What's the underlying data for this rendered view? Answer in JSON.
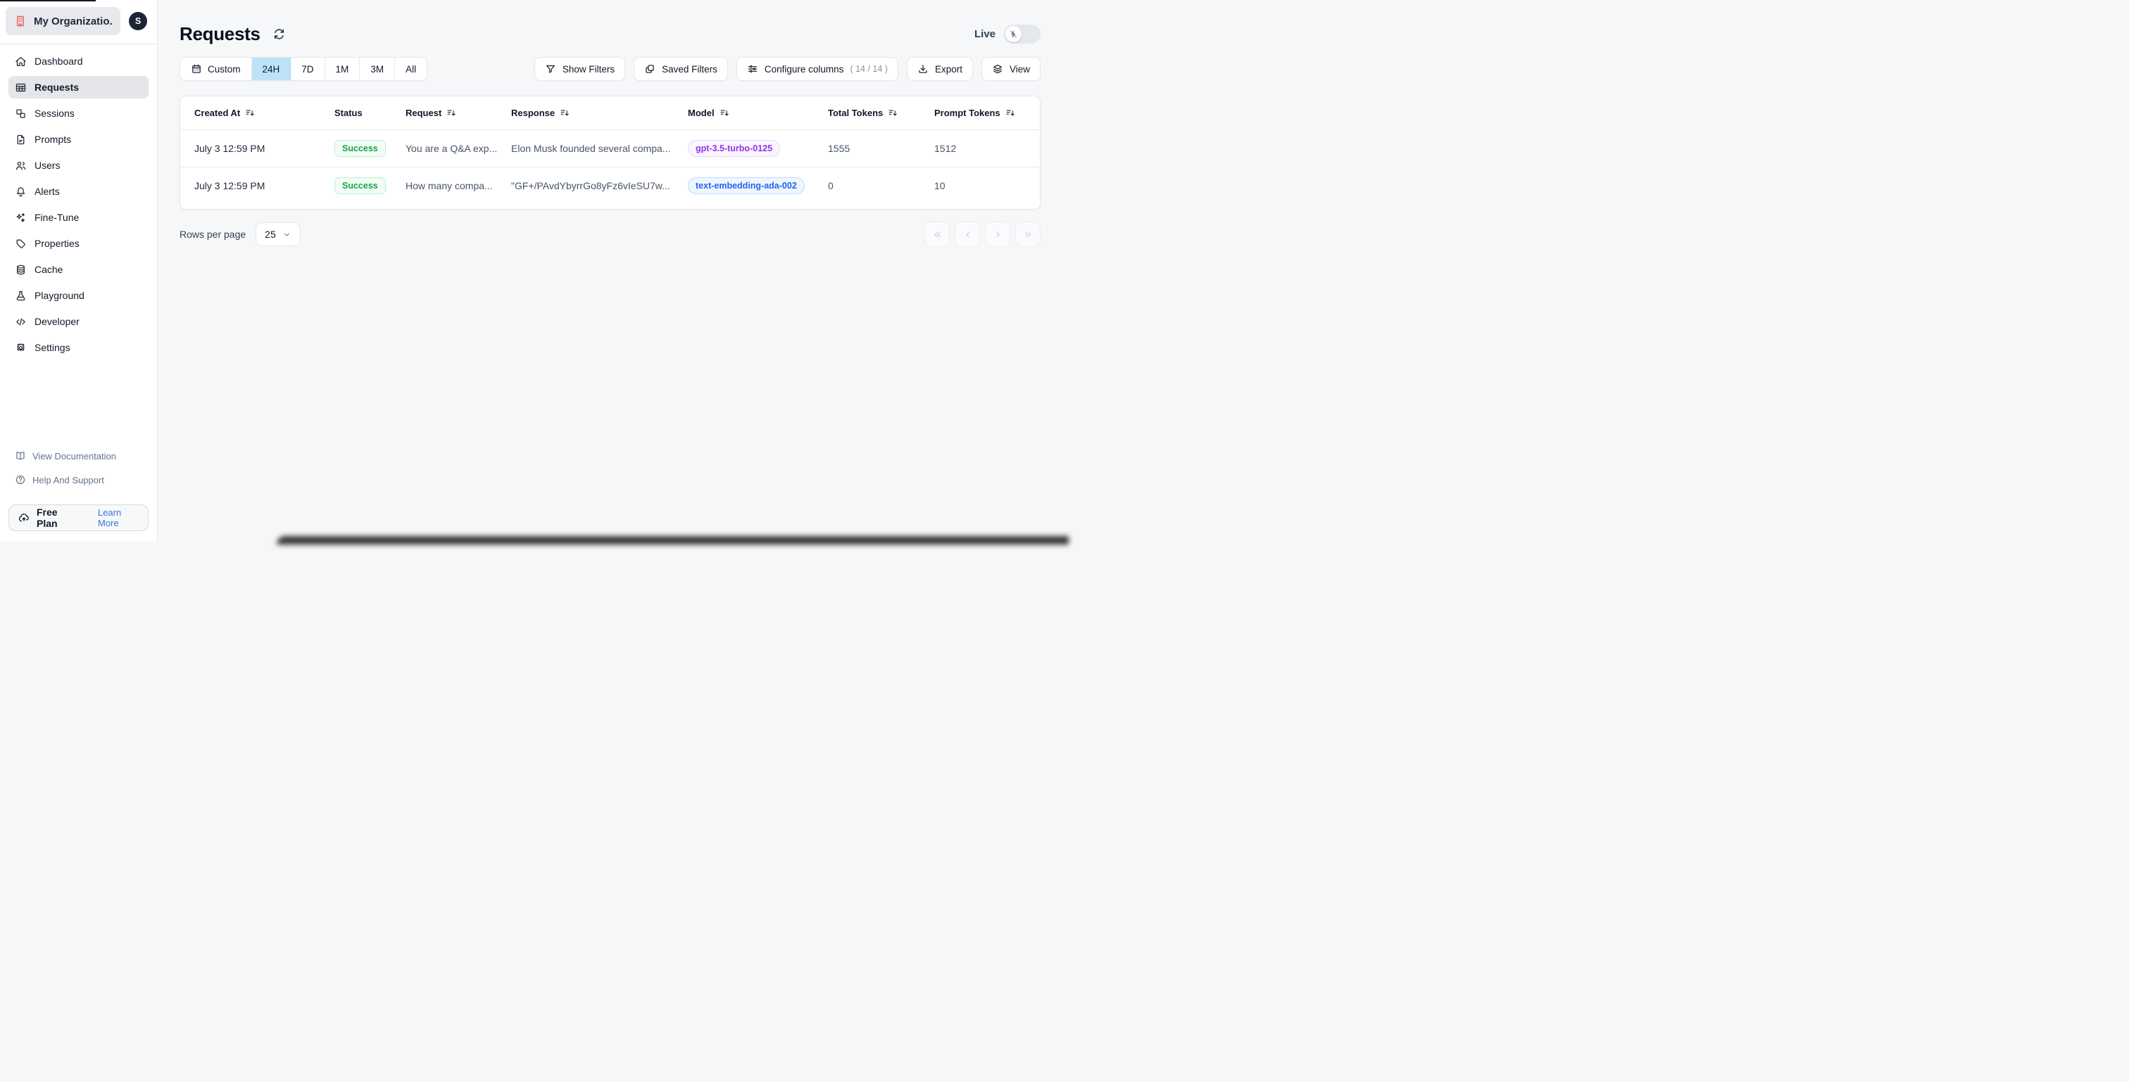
{
  "sidebar": {
    "org": {
      "name": "My Organizatio...",
      "avatar_initial": "S"
    },
    "nav": [
      {
        "label": "Dashboard",
        "icon": "home-icon",
        "active": false
      },
      {
        "label": "Requests",
        "icon": "table-icon",
        "active": true
      },
      {
        "label": "Sessions",
        "icon": "sessions-icon",
        "active": false
      },
      {
        "label": "Prompts",
        "icon": "document-icon",
        "active": false
      },
      {
        "label": "Users",
        "icon": "users-icon",
        "active": false
      },
      {
        "label": "Alerts",
        "icon": "bell-icon",
        "active": false
      },
      {
        "label": "Fine-Tune",
        "icon": "sparkles-icon",
        "active": false
      },
      {
        "label": "Properties",
        "icon": "tag-icon",
        "active": false
      },
      {
        "label": "Cache",
        "icon": "database-icon",
        "active": false
      },
      {
        "label": "Playground",
        "icon": "beaker-icon",
        "active": false
      },
      {
        "label": "Developer",
        "icon": "code-icon",
        "active": false
      },
      {
        "label": "Settings",
        "icon": "gear-icon",
        "active": false
      }
    ],
    "footer_links": [
      {
        "label": "View Documentation",
        "icon": "book-open-icon"
      },
      {
        "label": "Help And Support",
        "icon": "question-circle-icon"
      }
    ],
    "plan": {
      "label": "Free Plan",
      "link": "Learn More"
    }
  },
  "header": {
    "title": "Requests",
    "live_label": "Live",
    "live_on": false
  },
  "toolbar": {
    "time_ranges": [
      "Custom",
      "24H",
      "7D",
      "1M",
      "3M",
      "All"
    ],
    "selected_range": "24H",
    "show_filters_label": "Show Filters",
    "saved_filters_label": "Saved Filters",
    "configure_columns_label": "Configure columns",
    "configure_columns_count": "( 14 / 14 )",
    "export_label": "Export",
    "view_label": "View"
  },
  "table": {
    "columns": [
      {
        "label": "Created At",
        "sortable": true
      },
      {
        "label": "Status",
        "sortable": false
      },
      {
        "label": "Request",
        "sortable": true
      },
      {
        "label": "Response",
        "sortable": true
      },
      {
        "label": "Model",
        "sortable": true
      },
      {
        "label": "Total Tokens",
        "sortable": true
      },
      {
        "label": "Prompt Tokens",
        "sortable": true
      }
    ],
    "rows": [
      {
        "created_at": "July 3 12:59 PM",
        "status": "Success",
        "request": "You are a Q&A exp...",
        "response": "Elon Musk founded several compa...",
        "model": "gpt-3.5-turbo-0125",
        "model_color": "purple",
        "total_tokens": "1555",
        "prompt_tokens": "1512"
      },
      {
        "created_at": "July 3 12:59 PM",
        "status": "Success",
        "request": "How many compa...",
        "response": "\"GF+/PAvdYbyrrGo8yFz6vIeSU7w...",
        "model": "text-embedding-ada-002",
        "model_color": "blue",
        "total_tokens": "0",
        "prompt_tokens": "10"
      }
    ]
  },
  "pagination": {
    "rows_per_page_label": "Rows per page",
    "rows_per_page_value": "25"
  },
  "colors": {
    "selected_range_bg": "#bee3f8",
    "success_text": "#16a34a",
    "success_bg": "#f2fdf5",
    "model_purple": "#9333ea",
    "model_blue": "#2563eb",
    "org_icon_red": "#e8564f",
    "learn_more_blue": "#2f7ad9",
    "sidebar_active_bg": "#e4e6ea",
    "page_bg": "#f6f7f8"
  }
}
